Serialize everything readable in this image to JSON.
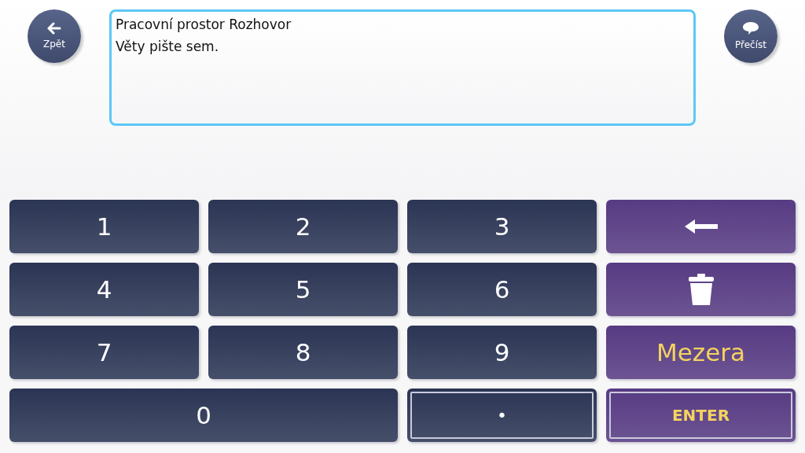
{
  "back_button": {
    "label": "Zpět"
  },
  "read_button": {
    "label": "Přečíst"
  },
  "workspace": {
    "title": "Pracovní prostor Rozhovor",
    "placeholder": "Věty pište sem."
  },
  "keys": [
    {
      "kind": "digit",
      "label": "1",
      "color": "#2b3554",
      "outlined": false,
      "wide": false
    },
    {
      "kind": "digit",
      "label": "2",
      "color": "#2b3554",
      "outlined": false,
      "wide": false
    },
    {
      "kind": "digit",
      "label": "3",
      "color": "#2b3554",
      "outlined": false,
      "wide": false
    },
    {
      "kind": "backspace",
      "color": "#573b83",
      "outlined": false,
      "wide": false
    },
    {
      "kind": "digit",
      "label": "4",
      "color": "#2b3554",
      "outlined": false,
      "wide": false
    },
    {
      "kind": "digit",
      "label": "5",
      "color": "#2b3554",
      "outlined": false,
      "wide": false
    },
    {
      "kind": "digit",
      "label": "6",
      "color": "#2b3554",
      "outlined": false,
      "wide": false
    },
    {
      "kind": "clear",
      "color": "#573b83",
      "outlined": false,
      "wide": false
    },
    {
      "kind": "digit",
      "label": "7",
      "color": "#2b3554",
      "outlined": false,
      "wide": false
    },
    {
      "kind": "digit",
      "label": "8",
      "color": "#2b3554",
      "outlined": false,
      "wide": false
    },
    {
      "kind": "digit",
      "label": "9",
      "color": "#2b3554",
      "outlined": false,
      "wide": false
    },
    {
      "kind": "word",
      "label": "Mezera",
      "color": "#573b83",
      "outlined": false,
      "wide": false
    },
    {
      "kind": "digit",
      "label": "0",
      "color": "#2b3554",
      "outlined": false,
      "wide": true
    },
    {
      "kind": "dot",
      "label": "•",
      "color": "#2b3554",
      "outlined": true,
      "wide": false
    },
    {
      "kind": "enter",
      "label": "ENTER",
      "color": "#573b83",
      "outlined": true,
      "wide": false
    }
  ]
}
